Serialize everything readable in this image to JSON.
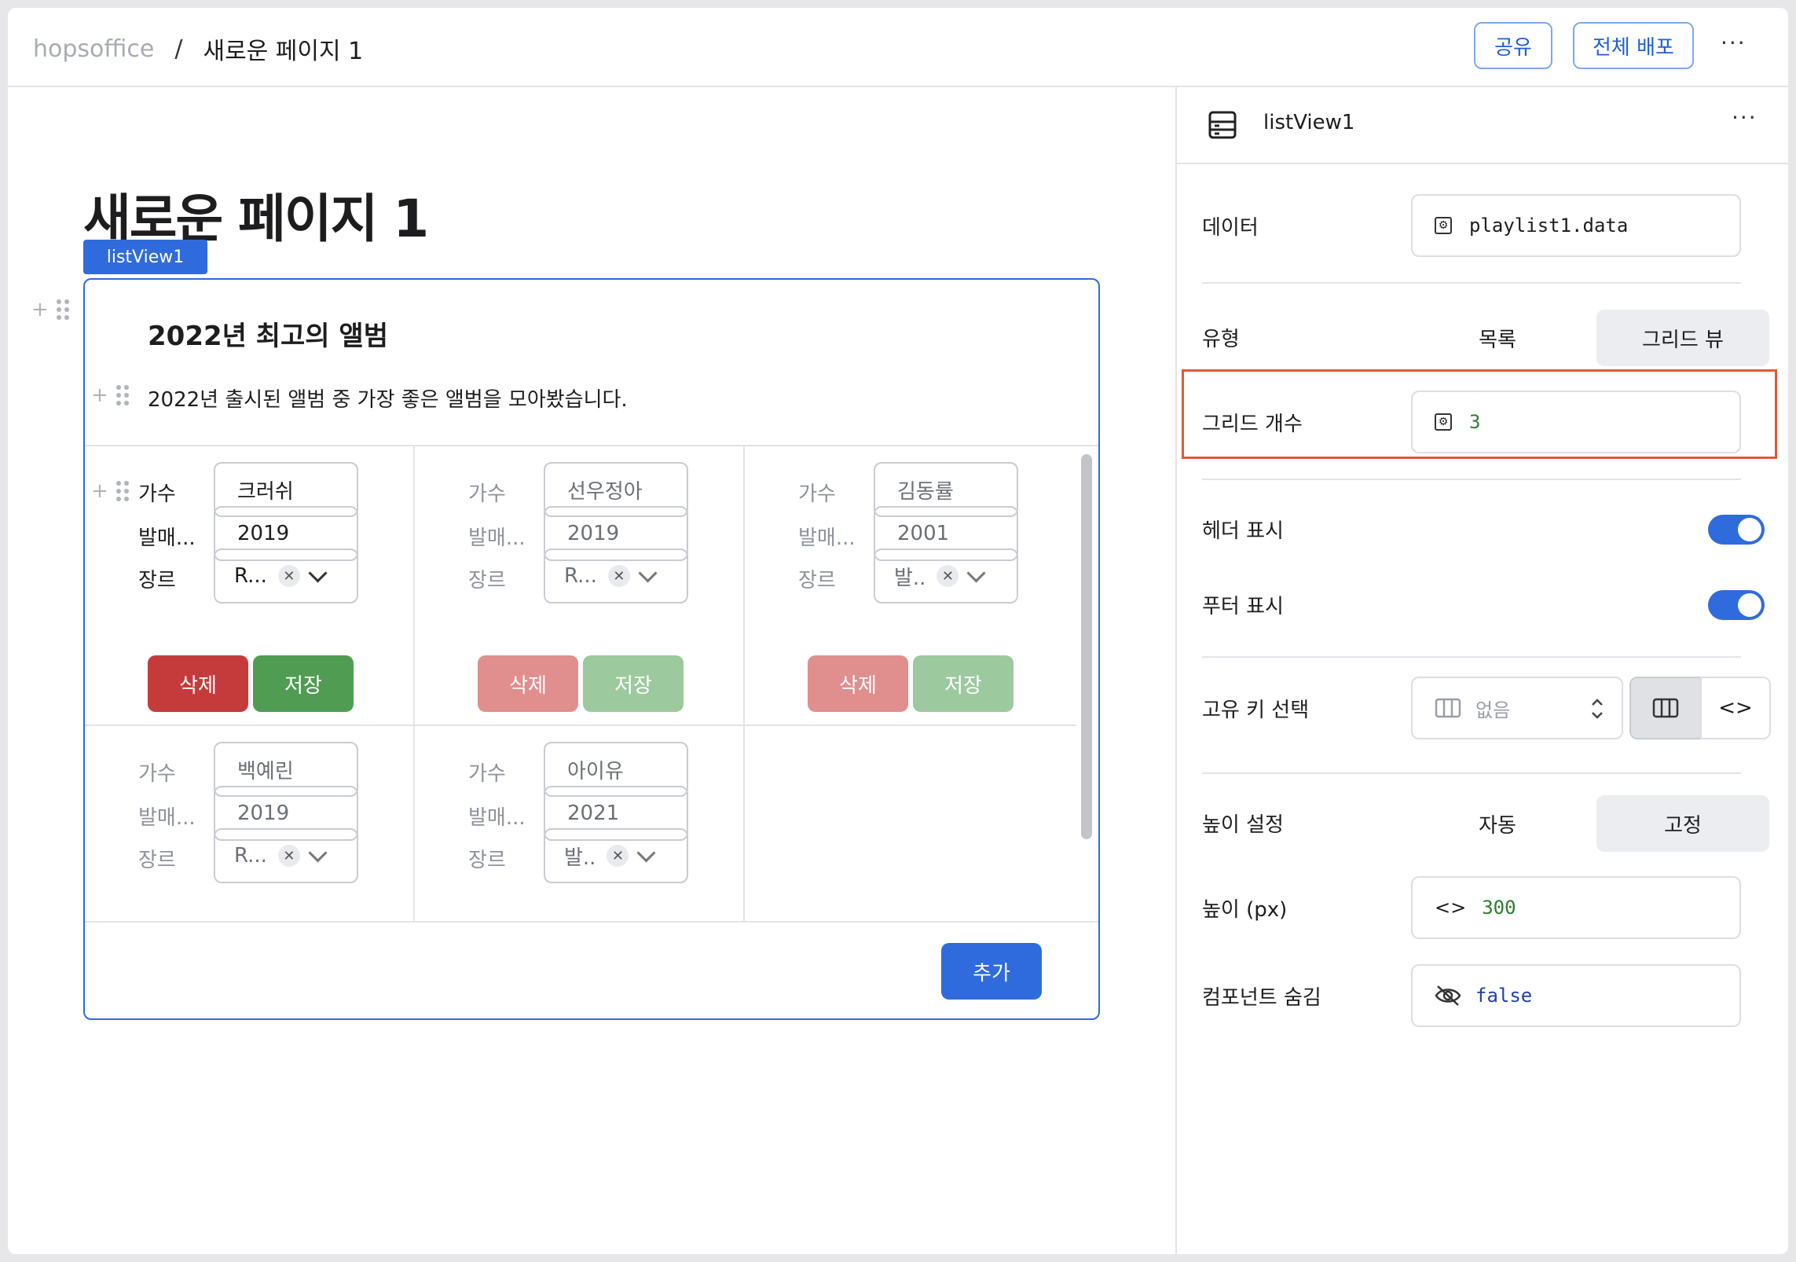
{
  "topbar": {
    "org": "hopsoffice",
    "separator": "/",
    "page": "새로운 페이지 1",
    "share_label": "공유",
    "deploy_label": "전체 배포",
    "more": "···"
  },
  "canvas": {
    "page_title": "새로운 페이지 1",
    "component_tag": "listView1",
    "list_header_title": "2022년 최고의 앨범",
    "list_header_desc": "2022년 출시된 앨범 중 가장 좋은 앨범을 모아봤습니다.",
    "labels": {
      "singer": "가수",
      "release": "발매...",
      "genre": "장르"
    },
    "buttons": {
      "delete": "삭제",
      "save": "저장",
      "add": "추가"
    },
    "items": [
      {
        "singer": "크러쉬",
        "release": "2019",
        "genre": "R...",
        "active": true
      },
      {
        "singer": "선우정아",
        "release": "2019",
        "genre": "R...",
        "active": false
      },
      {
        "singer": "김동률",
        "release": "2001",
        "genre": "발..",
        "active": false
      },
      {
        "singer": "백예린",
        "release": "2019",
        "genre": "R...",
        "active": false
      },
      {
        "singer": "아이유",
        "release": "2021",
        "genre": "발..",
        "active": false
      }
    ]
  },
  "panel": {
    "component_name": "listView1",
    "more": "···",
    "data_label": "데이터",
    "data_value": "playlist1.data",
    "type_label": "유형",
    "type_options": [
      "목록",
      "그리드 뷰"
    ],
    "type_selected": "그리드 뷰",
    "grid_count_label": "그리드 개수",
    "grid_count_value": "3",
    "show_header_label": "헤더 표시",
    "show_header": true,
    "show_footer_label": "푸터 표시",
    "show_footer": true,
    "unique_key_label": "고유 키 선택",
    "unique_key_placeholder": "없음",
    "height_mode_label": "높이 설정",
    "height_options": [
      "자동",
      "고정"
    ],
    "height_selected": "고정",
    "height_px_label": "높이 (px)",
    "height_px_value": "300",
    "hidden_label": "컴포넌트 숨김",
    "hidden_value": "false"
  },
  "colors": {
    "accent": "#2f6bdc",
    "danger": "#c53b3c",
    "success": "#4f9c52",
    "highlight": "#e05a35"
  }
}
